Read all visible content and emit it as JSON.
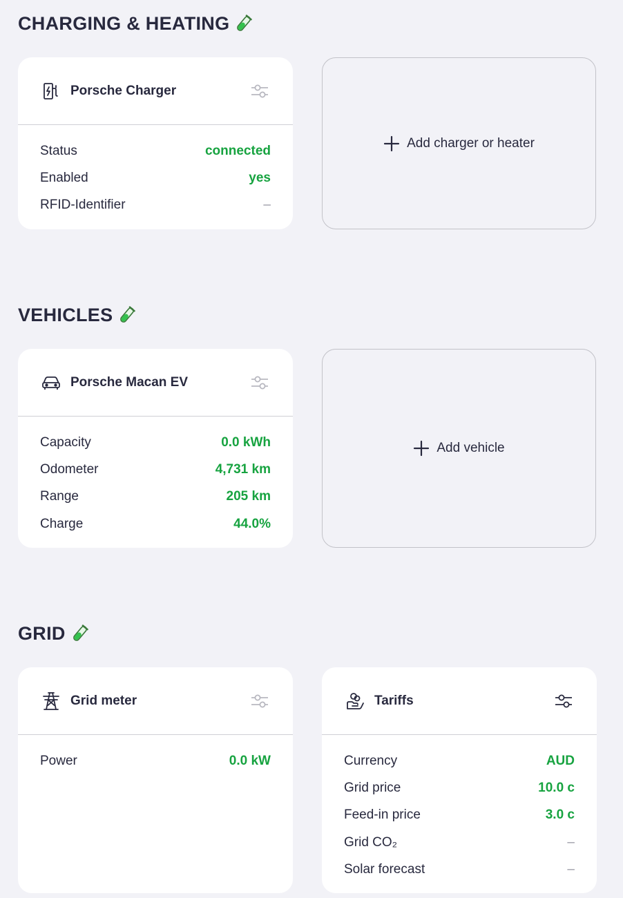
{
  "sections": {
    "charging": {
      "title": "CHARGING & HEATING",
      "charger_card": {
        "title": "Porsche Charger",
        "rows": [
          {
            "label": "Status",
            "value": "connected"
          },
          {
            "label": "Enabled",
            "value": "yes"
          },
          {
            "label": "RFID-Identifier",
            "value": "–"
          }
        ]
      },
      "add_label": "Add charger or heater"
    },
    "vehicles": {
      "title": "VEHICLES",
      "vehicle_card": {
        "title": "Porsche Macan EV",
        "rows": [
          {
            "label": "Capacity",
            "value": "0.0 kWh"
          },
          {
            "label": "Odometer",
            "value": "4,731 km"
          },
          {
            "label": "Range",
            "value": "205 km"
          },
          {
            "label": "Charge",
            "value": "44.0%"
          }
        ]
      },
      "add_label": "Add vehicle"
    },
    "grid": {
      "title": "GRID",
      "meter_card": {
        "title": "Grid meter",
        "rows": [
          {
            "label": "Power",
            "value": "0.0 kW"
          }
        ]
      },
      "tariffs_card": {
        "title": "Tariffs",
        "rows": [
          {
            "label": "Currency",
            "value": "AUD"
          },
          {
            "label": "Grid price",
            "value": "10.0 c"
          },
          {
            "label": "Feed-in price",
            "value": "3.0 c"
          },
          {
            "label": "Grid CO₂",
            "value": "–"
          },
          {
            "label": "Solar forecast",
            "value": "–"
          }
        ]
      }
    }
  },
  "colors": {
    "accent": "#17a340",
    "text": "#28293e",
    "background": "#f2f2f7"
  },
  "icons": [
    "test-tube-icon",
    "charger-icon",
    "car-icon",
    "power-tower-icon",
    "hand-coins-icon",
    "sliders-icon",
    "plus-icon"
  ]
}
